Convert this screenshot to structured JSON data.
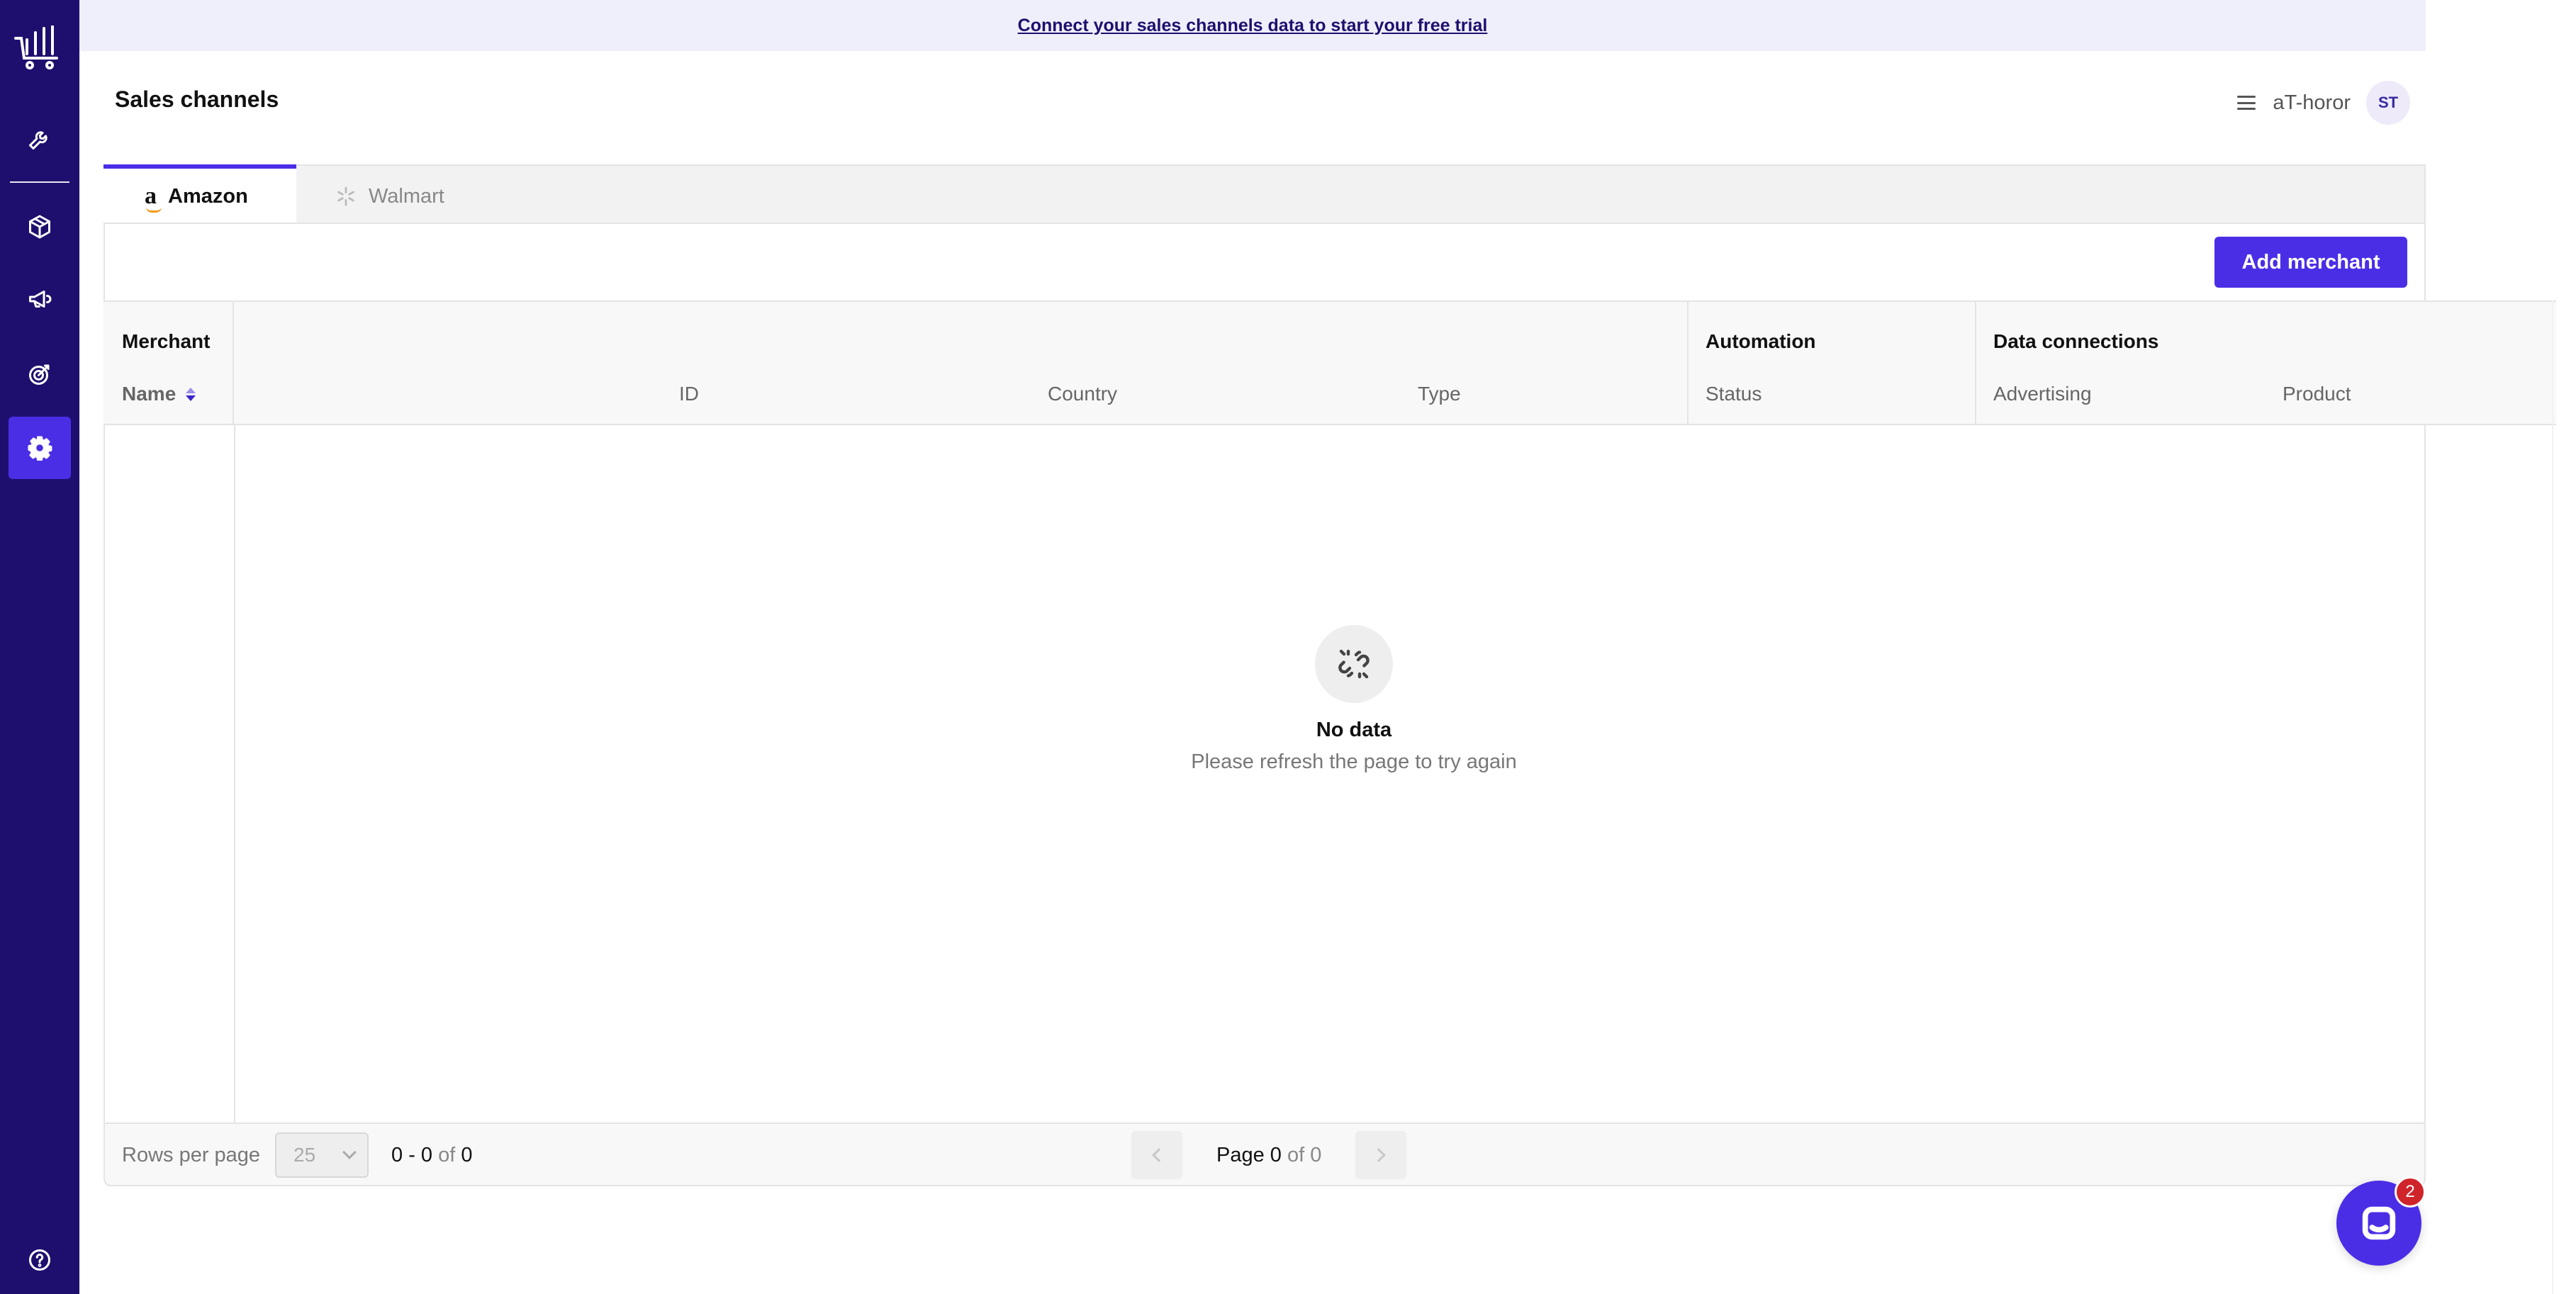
{
  "banner": {
    "text": "Connect your sales channels data to start your free trial"
  },
  "header": {
    "title": "Sales channels",
    "org_name": "aT-horor",
    "avatar_initials": "ST"
  },
  "sidebar": {
    "items": [
      {
        "name": "logo",
        "icon": "chart-cart-logo",
        "active": false
      },
      {
        "name": "tools",
        "icon": "wrench-icon",
        "active": false
      },
      {
        "name": "products",
        "icon": "box-icon",
        "active": false
      },
      {
        "name": "advertising",
        "icon": "megaphone-icon",
        "active": false
      },
      {
        "name": "goals",
        "icon": "target-icon",
        "active": false
      },
      {
        "name": "settings",
        "icon": "gear-icon",
        "active": true
      },
      {
        "name": "help",
        "icon": "help-icon",
        "active": false
      }
    ]
  },
  "tabs": [
    {
      "label": "Amazon",
      "active": true
    },
    {
      "label": "Walmart",
      "active": false
    }
  ],
  "toolbar": {
    "add_label": "Add merchant"
  },
  "table": {
    "groups": {
      "merchant": "Merchant",
      "automation": "Automation",
      "data_connections": "Data connections"
    },
    "columns": {
      "name": "Name",
      "id": "ID",
      "country": "Country",
      "type": "Type",
      "status": "Status",
      "advertising": "Advertising",
      "product": "Product"
    },
    "sort": {
      "column": "Name",
      "direction": "descending"
    }
  },
  "empty": {
    "title": "No data",
    "subtitle": "Please refresh the page to try again"
  },
  "pagination": {
    "rows_label": "Rows per page",
    "rows_value": "25",
    "range_from": "0",
    "range_to": "0",
    "of_word": "of",
    "total": "0",
    "page_word": "Page",
    "page_current": "0",
    "page_total": "0"
  },
  "chat": {
    "badge_count": "2"
  },
  "colors": {
    "sidebar_bg": "#1e0f6e",
    "accent": "#4a2ee6",
    "banner_bg": "#efeffb",
    "badge": "#d0242b"
  }
}
